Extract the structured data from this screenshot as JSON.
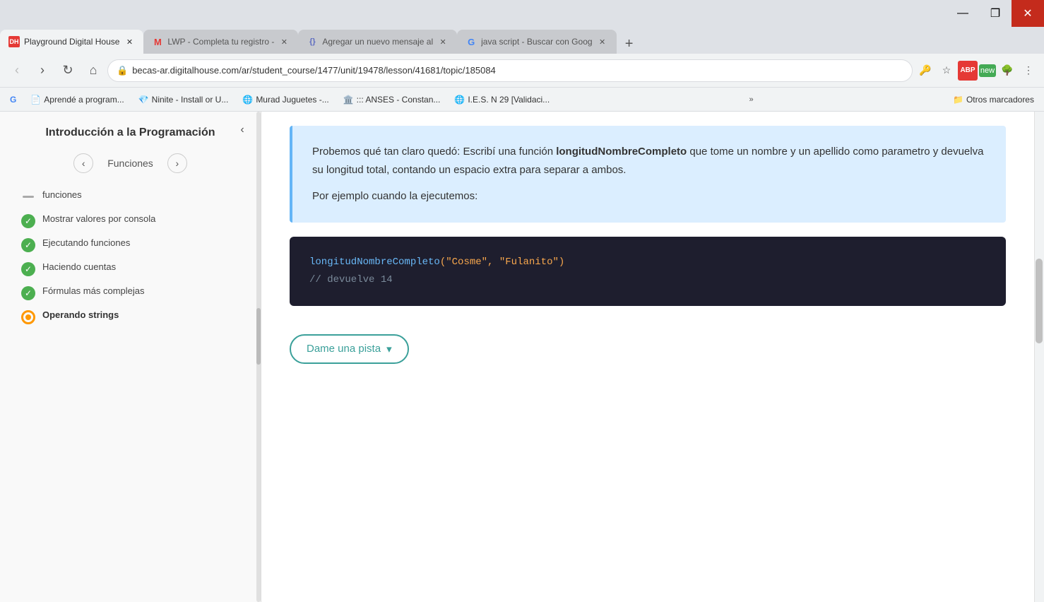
{
  "browser": {
    "title_bar": {
      "minimize_label": "—",
      "maximize_label": "❐",
      "close_label": "✕"
    },
    "tabs": [
      {
        "id": "tab1",
        "favicon": "DH",
        "favicon_color": "#e53935",
        "label": "Playground Digital House",
        "active": true
      },
      {
        "id": "tab2",
        "favicon": "M",
        "favicon_color": "#e53935",
        "label": "LWP - Completa tu registro -",
        "active": false
      },
      {
        "id": "tab3",
        "favicon": "{}",
        "favicon_color": "#5c6bc0",
        "label": "Agregar un nuevo mensaje al",
        "active": false
      },
      {
        "id": "tab4",
        "favicon": "G",
        "favicon_color": "#4285f4",
        "label": "java script - Buscar con Goog",
        "active": false
      }
    ],
    "new_tab_label": "+",
    "address": "becas-ar.digitalhouse.com/ar/student_course/1477/unit/19478/lesson/41681/topic/185084",
    "nav": {
      "back_label": "‹",
      "forward_label": "›",
      "refresh_label": "↻",
      "home_label": "⌂"
    }
  },
  "bookmarks": [
    {
      "label": "Aprendé a program..."
    },
    {
      "label": "Ninite - Install or U..."
    },
    {
      "label": "Murad Juguetes -..."
    },
    {
      "label": "::: ANSES - Constan..."
    },
    {
      "label": "I.E.S. N 29 [Validaci..."
    }
  ],
  "bookmarks_more": "»",
  "bookmarks_folder_label": "Otros marcadores",
  "sidebar": {
    "title": "Introducción a la Programación",
    "section": "Funciones",
    "items": [
      {
        "id": "item1",
        "icon": "dash",
        "label": "funciones",
        "active": false
      },
      {
        "id": "item2",
        "icon": "check",
        "label": "Mostrar valores por consola",
        "active": false
      },
      {
        "id": "item3",
        "icon": "check",
        "label": "Ejecutando funciones",
        "active": false
      },
      {
        "id": "item4",
        "icon": "check",
        "label": "Haciendo cuentas",
        "active": false
      },
      {
        "id": "item5",
        "icon": "check",
        "label": "Fórmulas más complejas",
        "active": false
      },
      {
        "id": "item6",
        "icon": "orange",
        "label": "Operando strings",
        "active": true
      }
    ]
  },
  "main": {
    "info_box": {
      "paragraph1_prefix": "Probemos qué tan claro quedó: Escribí una función ",
      "function_name": "longitudNombreCompleto",
      "paragraph1_suffix": " que tome un nombre y un apellido como parametro y devuelva su longitud total, contando un espacio extra para separar a ambos.",
      "paragraph2": "Por ejemplo cuando la ejecutemos:"
    },
    "code_block": {
      "line1_fn": "longitudNombreCompleto",
      "line1_args": "(\"Cosme\", \"Fulanito\")",
      "line2_comment": "// devuelve 14"
    },
    "hint_button": {
      "label": "Dame una pista",
      "icon": "▾"
    }
  }
}
